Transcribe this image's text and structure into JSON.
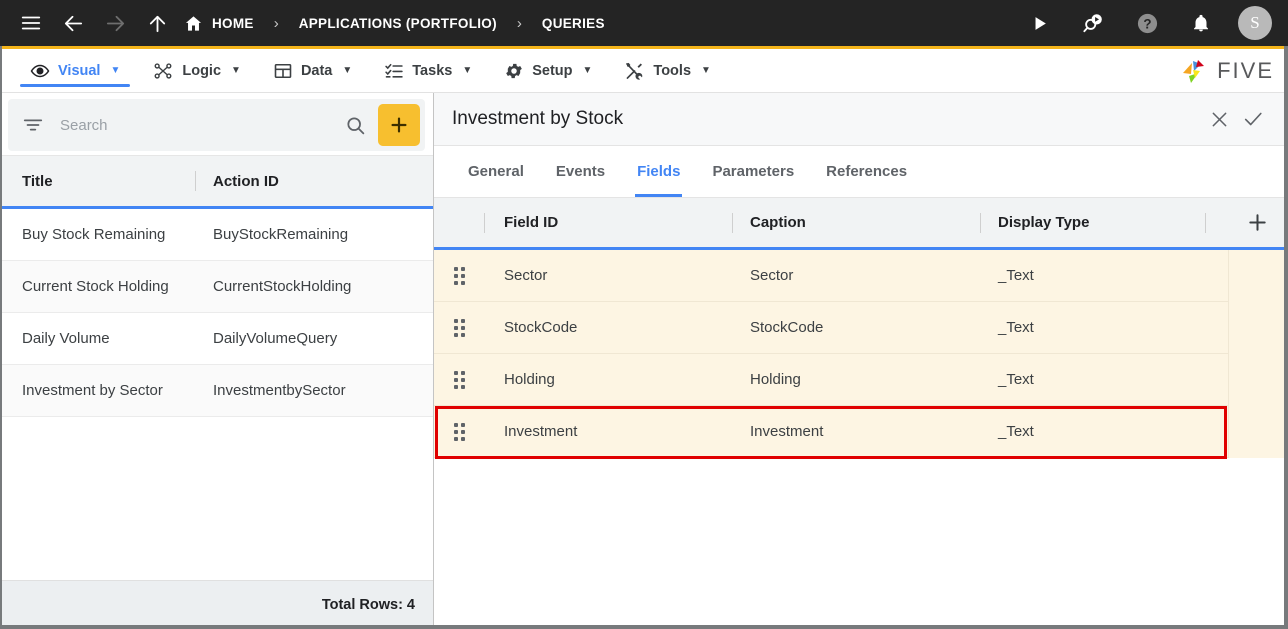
{
  "topbar": {
    "menu_icon": "hamburger-icon",
    "back_icon": "back-arrow-icon",
    "forward_icon": "forward-arrow-icon",
    "up_icon": "up-arrow-icon",
    "home_icon": "home-icon",
    "breadcrumbs": [
      {
        "label": "HOME"
      },
      {
        "label": "APPLICATIONS (PORTFOLIO)"
      },
      {
        "label": "QUERIES"
      }
    ],
    "separator": "›",
    "actions": [
      {
        "name": "run-icon"
      },
      {
        "name": "search-run-icon"
      },
      {
        "name": "help-icon"
      },
      {
        "name": "notifications-icon"
      }
    ],
    "avatar_initial": "S",
    "background": "#242424"
  },
  "menubar": {
    "accent_top": "#f4b41a",
    "active_color": "#4285f4",
    "caret": "▼",
    "items": [
      {
        "label": "Visual",
        "icon": "eye-icon",
        "active": true
      },
      {
        "label": "Logic",
        "icon": "logic-nodes-icon",
        "active": false
      },
      {
        "label": "Data",
        "icon": "table-icon",
        "active": false
      },
      {
        "label": "Tasks",
        "icon": "checklist-icon",
        "active": false
      },
      {
        "label": "Setup",
        "icon": "gear-icon",
        "active": false
      },
      {
        "label": "Tools",
        "icon": "tools-icon",
        "active": false
      }
    ],
    "brand": "FIVE"
  },
  "sidebar": {
    "search": {
      "placeholder": "Search",
      "value": "",
      "filter_icon": "filter-icon",
      "search_icon": "search-icon"
    },
    "add_button": {
      "label": "+",
      "color": "#f7bf2f"
    },
    "columns": [
      "Title",
      "Action ID"
    ],
    "rows": [
      {
        "title": "Buy Stock Remaining",
        "action_id": "BuyStockRemaining"
      },
      {
        "title": "Current Stock Holding",
        "action_id": "CurrentStockHolding"
      },
      {
        "title": "Daily Volume",
        "action_id": "DailyVolumeQuery"
      },
      {
        "title": "Investment by Sector",
        "action_id": "InvestmentbySector"
      }
    ],
    "footer": "Total Rows: 4"
  },
  "detail": {
    "title": "Investment by Stock",
    "close_icon": "close-icon",
    "confirm_icon": "check-icon",
    "tabs": [
      {
        "label": "General",
        "active": false
      },
      {
        "label": "Events",
        "active": false
      },
      {
        "label": "Fields",
        "active": true
      },
      {
        "label": "Parameters",
        "active": false
      },
      {
        "label": "References",
        "active": false
      }
    ],
    "grid": {
      "columns": [
        "Field ID",
        "Caption",
        "Display Type"
      ],
      "add_column_icon": "plus-icon",
      "drag_handle_icon": "drag-handle-icon",
      "rows": [
        {
          "field_id": "Sector",
          "caption": "Sector",
          "display_type": "_Text",
          "highlighted": false
        },
        {
          "field_id": "StockCode",
          "caption": "StockCode",
          "display_type": "_Text",
          "highlighted": false
        },
        {
          "field_id": "Holding",
          "caption": "Holding",
          "display_type": "_Text",
          "highlighted": false
        },
        {
          "field_id": "Investment",
          "caption": "Investment",
          "display_type": "_Text",
          "highlighted": true
        }
      ],
      "row_background": "#fdf5e3",
      "highlight_color": "#e00000"
    }
  }
}
